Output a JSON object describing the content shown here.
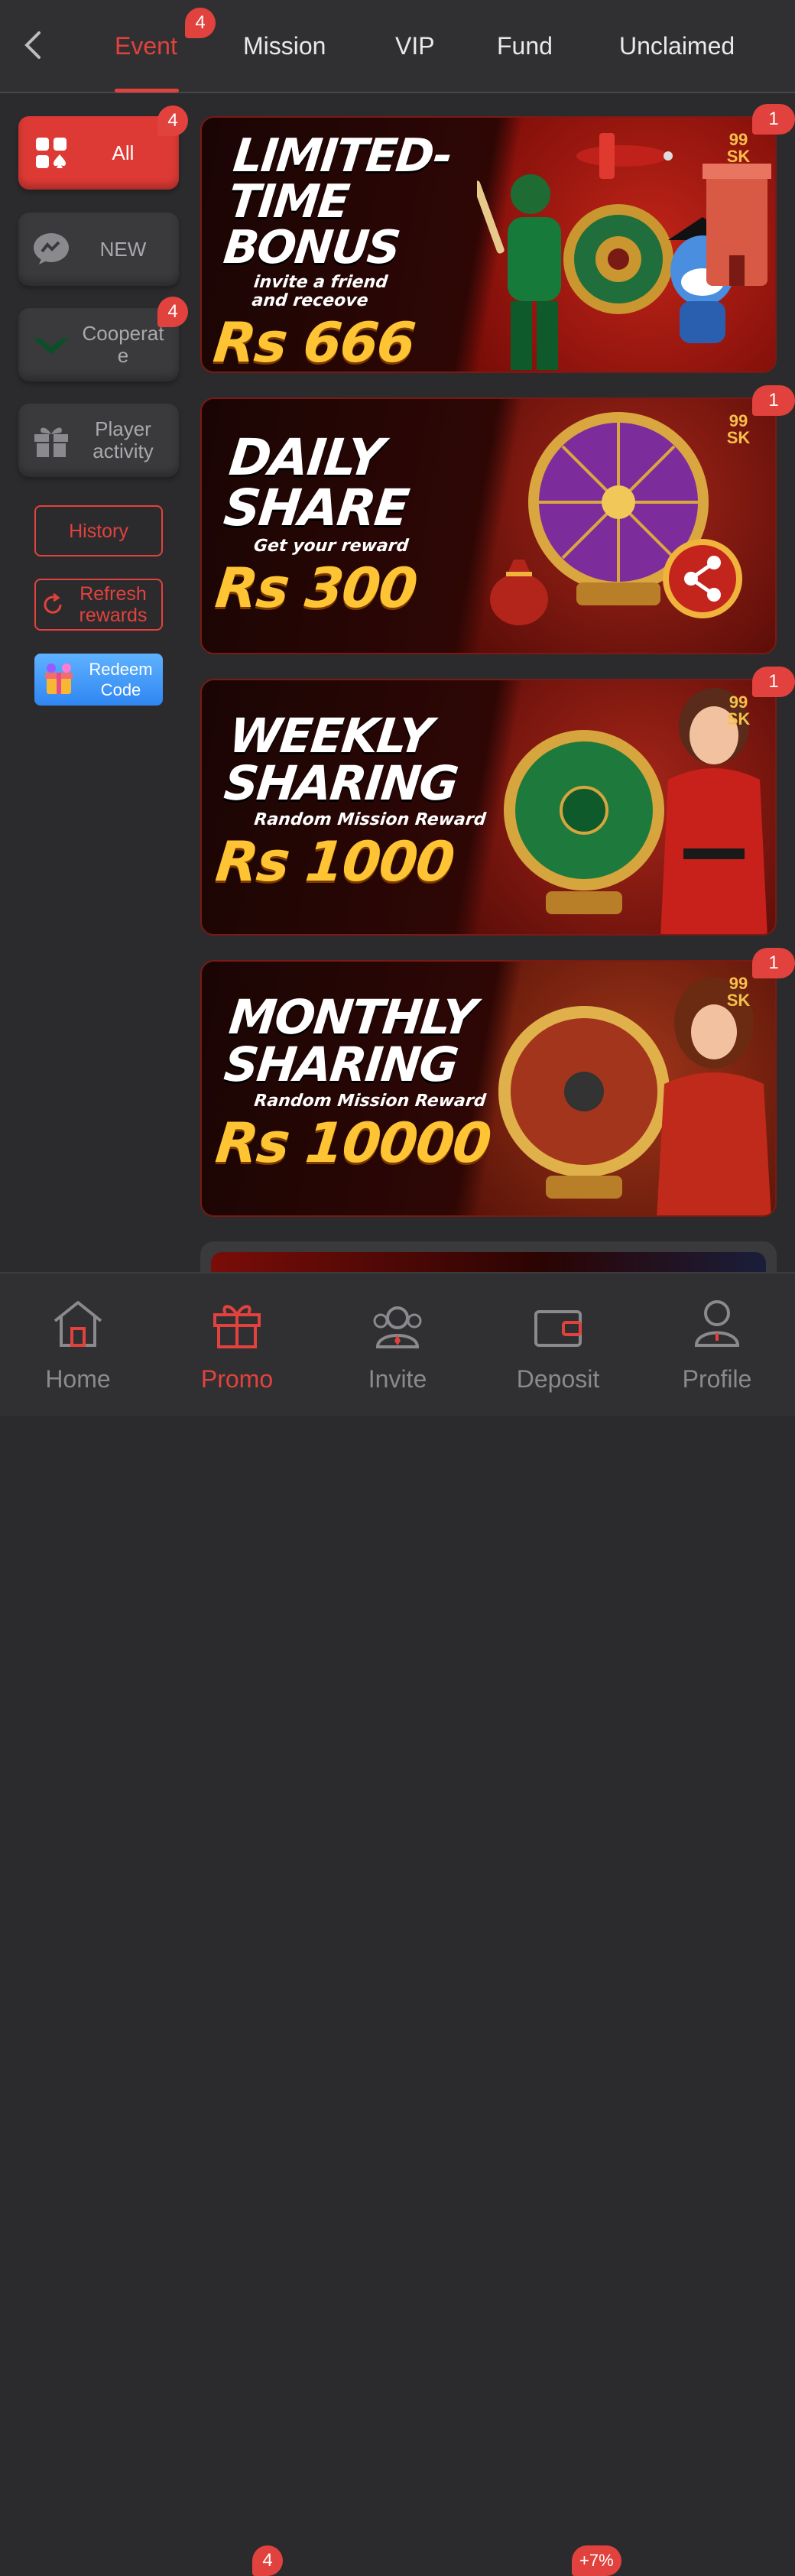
{
  "header": {
    "tabs": [
      {
        "label": "Event",
        "badge": "4"
      },
      {
        "label": "Mission"
      },
      {
        "label": "VIP"
      },
      {
        "label": "Fund"
      },
      {
        "label": "Unclaimed"
      }
    ]
  },
  "sidebar": {
    "items": [
      {
        "label": "All",
        "badge": "4"
      },
      {
        "label": "NEW"
      },
      {
        "label": "Cooperat e",
        "badge": "4"
      },
      {
        "label": "Player activity"
      }
    ],
    "history_label": "History",
    "refresh_label": "Refresh rewards",
    "redeem_label": "Redeem Code"
  },
  "banners": [
    {
      "title": "LIMITED-TIME BONUS",
      "subtitle": "invite a friend and receove",
      "amount": "Rs 666",
      "badge": "1",
      "logo": "99 SK"
    },
    {
      "title": "DAILY SHARE",
      "subtitle": "Get your reward",
      "amount": "Rs 300",
      "badge": "1",
      "logo": "99 SK"
    },
    {
      "title": "WEEKLY SHARING",
      "subtitle": "Random Mission Reward",
      "amount": "Rs 1000",
      "badge": "1",
      "logo": "99 SK"
    },
    {
      "title": "MONTHLY SHARING",
      "subtitle": "Random Mission Reward",
      "amount": "Rs 10000",
      "badge": "1",
      "logo": "99 SK"
    }
  ],
  "bottom_nav": [
    {
      "label": "Home"
    },
    {
      "label": "Promo",
      "badge": "4"
    },
    {
      "label": "Invite"
    },
    {
      "label": "Deposit",
      "badge": "+7%"
    },
    {
      "label": "Profile"
    }
  ],
  "colors": {
    "accent": "#e2423d",
    "background": "#2b2b2d",
    "gold": "#ffc433"
  }
}
